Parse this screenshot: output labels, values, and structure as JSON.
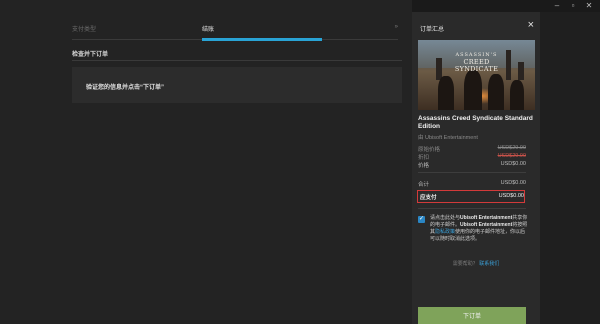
{
  "window": {
    "controls": [
      "–",
      "▫",
      "✕"
    ]
  },
  "checkout": {
    "steps": [
      {
        "label": "支付类型"
      },
      {
        "label": "结账"
      },
      {
        "label": "»"
      }
    ],
    "section_title": "检查并下订单",
    "confirm_text": "验证您的信息并点击“下订单”"
  },
  "summary": {
    "title": "订单汇总",
    "close_icon": "close-icon",
    "cover": {
      "logo_line1": "ASSASSIN'S",
      "logo_line2": "CREED",
      "logo_line3": "SYNDICATE"
    },
    "product_title": "Assassins Creed Syndicate Standard Edition",
    "publisher": "由 Ubisoft Entertainment",
    "prices": {
      "original_label": "原始价格",
      "original_value": "USD$29.99",
      "discount_label": "折扣",
      "discount_value": "USD$29.99",
      "price_label": "价格",
      "price_value": "USD$0.00",
      "subtotal_label": "合计",
      "subtotal_value": "USD$0.00",
      "total_label": "应支付",
      "total_value": "USD$0.00"
    },
    "consent": {
      "checked": true,
      "text_a": "请点击此处与",
      "text_b": "Ubisoft Entertainment",
      "text_c": "共享你的电子邮件。",
      "text_d": "Ubisoft Entertainment",
      "text_e": "将按照其",
      "link": "隐私政策",
      "text_f": "使用你的电子邮件地址，你以后可以随时取消此选项。"
    },
    "help_text": "需要帮助？",
    "help_link": "联系我们",
    "order_button": "下订单"
  }
}
